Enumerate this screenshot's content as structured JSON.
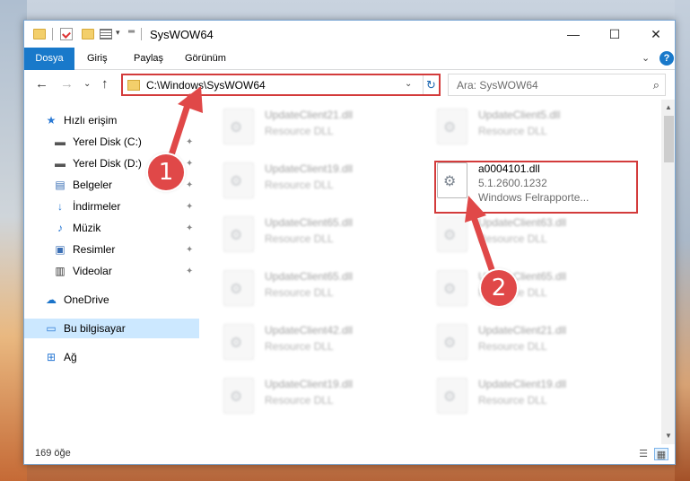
{
  "window": {
    "title": "SysWOW64",
    "controls": {
      "minimize": "—",
      "maximize": "☐",
      "close": "✕"
    }
  },
  "ribbon": {
    "tabs": [
      "Dosya",
      "Giriş",
      "Paylaş",
      "Görünüm"
    ],
    "help": "?",
    "collapse": "⌄"
  },
  "nav": {
    "back": "←",
    "forward": "→",
    "recent": "⌄",
    "up": "↑",
    "address": "C:\\Windows\\SysWOW64",
    "address_dropdown": "⌄",
    "refresh": "↻",
    "search_placeholder": "Ara: SysWOW64",
    "search_icon": "⌕"
  },
  "sidebar": {
    "items": [
      {
        "label": "Hızlı erişim",
        "icon": "star-icon",
        "glyph": "★",
        "pinned": false
      },
      {
        "label": "Yerel Disk (C:)",
        "icon": "drive-icon",
        "glyph": "▬",
        "pinned": true
      },
      {
        "label": "Yerel Disk (D:)",
        "icon": "drive-icon",
        "glyph": "▬",
        "pinned": true
      },
      {
        "label": "Belgeler",
        "icon": "documents-icon",
        "glyph": "▤",
        "pinned": true
      },
      {
        "label": "İndirmeler",
        "icon": "download-icon",
        "glyph": "↓",
        "pinned": true
      },
      {
        "label": "Müzik",
        "icon": "music-icon",
        "glyph": "♪",
        "pinned": true
      },
      {
        "label": "Resimler",
        "icon": "pictures-icon",
        "glyph": "▣",
        "pinned": true
      },
      {
        "label": "Videolar",
        "icon": "videos-icon",
        "glyph": "▥",
        "pinned": true
      },
      {
        "label": "OneDrive",
        "icon": "cloud-icon",
        "glyph": "☁",
        "pinned": false
      },
      {
        "label": "Bu bilgisayar",
        "icon": "computer-icon",
        "glyph": "▭",
        "pinned": false
      },
      {
        "label": "Ağ",
        "icon": "network-icon",
        "glyph": "⊞",
        "pinned": false
      }
    ],
    "pin_glyph": "📌"
  },
  "files": {
    "left_column": [
      {
        "name": "UpdateClient21.dll",
        "type": "Resource DLL"
      },
      {
        "name": "UpdateClient19.dll",
        "type": "Resource DLL"
      },
      {
        "name": "UpdateClient65.dll",
        "type": "Resource DLL"
      },
      {
        "name": "UpdateClient65.dll",
        "type": "Resource DLL"
      },
      {
        "name": "UpdateClient42.dll",
        "type": "Resource DLL"
      },
      {
        "name": "UpdateClient19.dll",
        "type": "Resource DLL"
      }
    ],
    "right_column": [
      {
        "name": "UpdateClient5.dll",
        "type": "Resource DLL"
      },
      {
        "name": "UpdateClient63.dll",
        "type": "Resource DLL"
      },
      {
        "name": "UpdateClient65.dll",
        "type": "Resource DLL"
      },
      {
        "name": "UpdateClient21.dll",
        "type": "Resource DLL"
      },
      {
        "name": "UpdateClient19.dll",
        "type": "Resource DLL"
      }
    ],
    "highlighted": {
      "name": "a0004101.dll",
      "version": "5.1.2600.1232",
      "description": "Windows Felrapporte..."
    }
  },
  "status": {
    "count": "169 öğe"
  },
  "annotations": {
    "callout_1": "1",
    "callout_2": "2",
    "accent_color": "#e04848"
  }
}
